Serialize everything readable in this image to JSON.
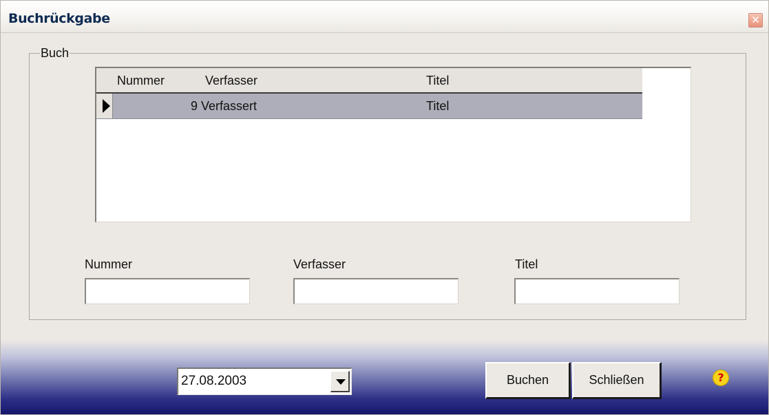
{
  "window": {
    "title": "Buchrückgabe"
  },
  "group": {
    "label": "Buch",
    "grid": {
      "columns": [
        "Nummer",
        "Verfasser",
        "Titel"
      ],
      "rows": [
        {
          "nummer": "9",
          "verfasser": "Verfassert",
          "titel": "Titel",
          "selected": true
        }
      ]
    },
    "fields": {
      "nummer": {
        "label": "Nummer",
        "value": ""
      },
      "verfasser": {
        "label": "Verfasser",
        "value": ""
      },
      "titel": {
        "label": "Titel",
        "value": ""
      }
    }
  },
  "footer": {
    "date": "27.08.2003",
    "buchen_label": "Buchen",
    "schliessen_label": "Schließen",
    "help_glyph": "?"
  },
  "icons": {
    "close": "close-icon",
    "row_indicator": "row-pointer-icon",
    "dropdown": "chevron-down-icon",
    "help": "help-icon"
  },
  "colors": {
    "title_text": "#0f2b52",
    "selected_row": "#aeaeba",
    "footer_dark": "#15156b",
    "help_yellow": "#f7d21a"
  }
}
